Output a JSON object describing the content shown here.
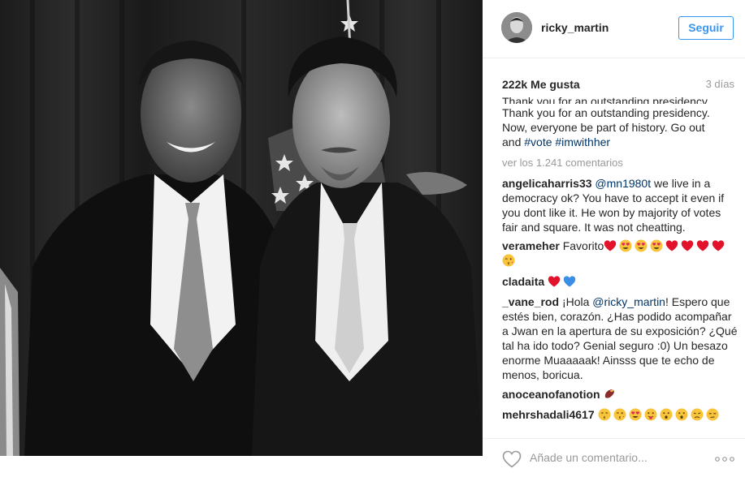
{
  "post": {
    "username": "ricky_martin",
    "follow_label": "Seguir",
    "likes": "222k Me gusta",
    "time_ago": "3 días",
    "caption_cut": "Thank you for an outstanding presidency.",
    "caption_line1": "Thank you for an outstanding presidency.",
    "caption_line2": "Now, everyone be part of history. Go out",
    "caption_line3_a": "and",
    "caption_tag1": "#vote",
    "caption_tag2": "#imwithher",
    "view_all": "ver los 1.241 comentarios",
    "photo_alt_icon": "photo-image",
    "colors": {
      "accent": "#3897f0",
      "link": "#003569",
      "muted": "#999999"
    }
  },
  "comments": [
    {
      "user": "angelicaharris33",
      "mention": "@mn1980t",
      "text": "we live in a democracy ok? You have to accept it even if you dont like it. He won by majority of votes fair and square. It was not cheatting."
    },
    {
      "user": "verameher",
      "text": "Favorito",
      "emojis": [
        "red-heart",
        "heart-eyes-face",
        "heart-eyes-face",
        "heart-eyes-face",
        "red-heart",
        "red-heart",
        "red-heart",
        "red-heart",
        "kissing-wink-face"
      ]
    },
    {
      "user": "cladaita",
      "emojis": [
        "red-heart",
        "blue-heart"
      ]
    },
    {
      "user": "_vane_rod",
      "pre": "¡Hola",
      "mention": "@ricky_martin",
      "text": "! Espero que estés bien, corazón. ¿Has podido acompañar a Jwan en la apertura de su exposición? ¿Qué tal ha ido todo? Genial seguro :0) Un besazo enorme Muaaaaak! Ainsss que te echo de menos, boricua."
    },
    {
      "user": "anoceanofanotion",
      "emojis": [
        "sweet-potato"
      ]
    },
    {
      "user": "mehrshadali4617",
      "emojis": [
        "kissing-smiling-eyes-face",
        "kissing-wink-face",
        "heart-eyes-face",
        "tongue-face",
        "hushed-face",
        "hushed-face",
        "disappointed-face",
        "unamused-face"
      ]
    }
  ],
  "footer": {
    "comment_placeholder": "Añade un comentario...",
    "like_icon": "heart-outline-icon",
    "more_icon": "more-options-icon"
  }
}
